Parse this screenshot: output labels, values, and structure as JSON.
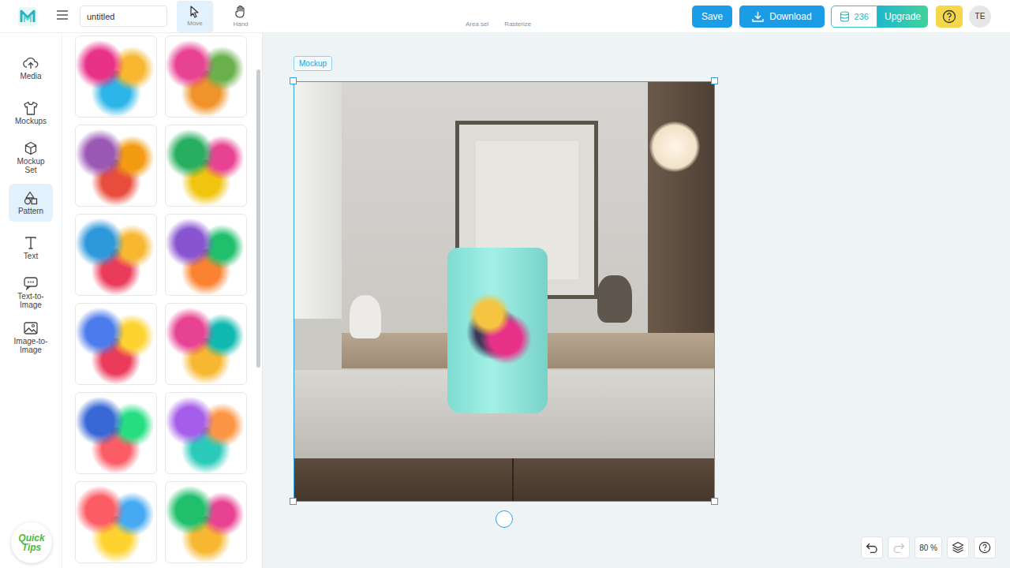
{
  "app": {
    "file_name": "untitled"
  },
  "tools": [
    {
      "label": "Move",
      "selected": true
    },
    {
      "label": "Hand",
      "selected": false
    }
  ],
  "actions": [
    "Area sel",
    "Rasterize"
  ],
  "header": {
    "save": "Save",
    "download": "Download",
    "credits": "236",
    "upgrade": "Upgrade",
    "avatar": "TE"
  },
  "sidebar": {
    "items": [
      {
        "label": "Media",
        "selected": false
      },
      {
        "label": "Mockups",
        "selected": false
      },
      {
        "label": "Mockup Set",
        "selected": false
      },
      {
        "label": "Pattern",
        "selected": true
      },
      {
        "label": "Text",
        "selected": false
      },
      {
        "label": "Text-to-Image",
        "selected": false
      },
      {
        "label": "Image-to-Image",
        "selected": false
      }
    ]
  },
  "quick_tips": "Quick Tips",
  "canvas": {
    "label": "Mockup"
  },
  "history": {
    "undo_disabled": false,
    "redo_disabled": true
  },
  "zoom": "80 %"
}
